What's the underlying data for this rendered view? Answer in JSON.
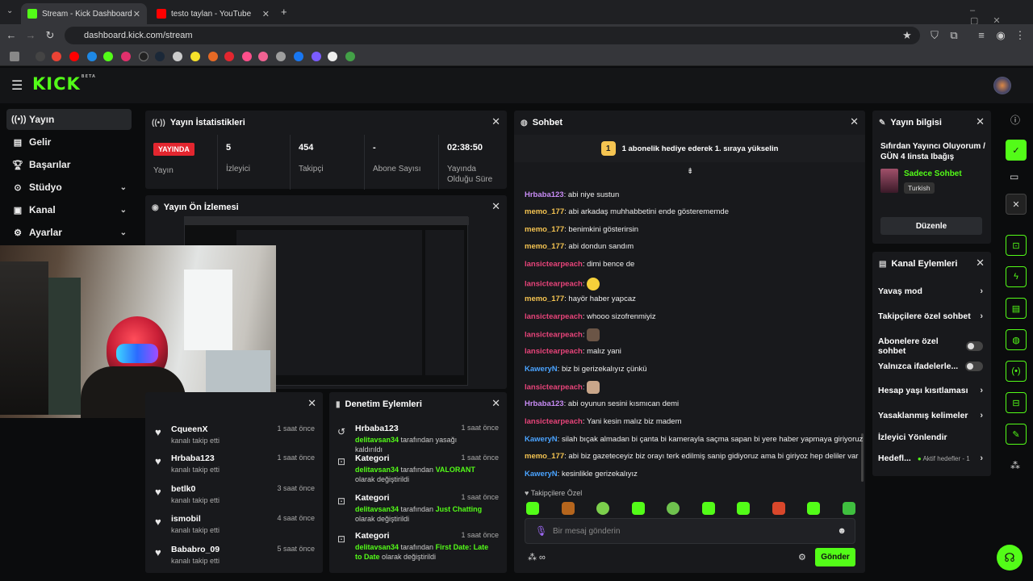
{
  "browser": {
    "tabs": [
      {
        "title": "Stream - Kick Dashboard",
        "active": true
      },
      {
        "title": "testo taylan - YouTube",
        "active": false
      }
    ],
    "url": "dashboard.kick.com/stream"
  },
  "colors": {
    "accent": "#53fc18",
    "live": "#e3262f",
    "panel": "#18191c"
  },
  "kick": {
    "logo": "KICK",
    "logo_tag": "BETA"
  },
  "sidebar": {
    "items": [
      {
        "label": "Yayın",
        "icon": "broadcast-icon"
      },
      {
        "label": "Gelir",
        "icon": "wallet-icon"
      },
      {
        "label": "Başarılar",
        "icon": "trophy-icon"
      },
      {
        "label": "Stüdyo",
        "icon": "studio-icon"
      },
      {
        "label": "Kanal",
        "icon": "channel-icon"
      },
      {
        "label": "Ayarlar",
        "icon": "gear-icon"
      }
    ]
  },
  "stats": {
    "title": "Yayın İstatistikleri",
    "live_badge": "YAYINDA",
    "items": [
      {
        "value": "",
        "label": "Yayın"
      },
      {
        "value": "5",
        "label": "İzleyici"
      },
      {
        "value": "454",
        "label": "Takipçi"
      },
      {
        "value": "-",
        "label": "Abone Sayısı"
      },
      {
        "value": "02:38:50",
        "label": "Yayında Olduğu Süre"
      }
    ]
  },
  "preview": {
    "title": "Yayın Ön İzlemesi"
  },
  "follows": {
    "items": [
      {
        "name": "CqueenX",
        "action": "kanalı takip etti",
        "time": "1 saat önce"
      },
      {
        "name": "Hrbaba123",
        "action": "kanalı takip etti",
        "time": "1 saat önce"
      },
      {
        "name": "betlk0",
        "action": "kanalı takip etti",
        "time": "3 saat önce"
      },
      {
        "name": "ismobil",
        "action": "kanalı takip etti",
        "time": "4 saat önce"
      },
      {
        "name": "Bababro_09",
        "action": "kanalı takip etti",
        "time": "5 saat önce"
      }
    ]
  },
  "moderation": {
    "title": "Denetim Eylemleri",
    "items": [
      {
        "title": "Hrbaba123",
        "actor": "delitavsan34",
        "pre": " tarafından yasağı kaldırıldı",
        "highlight": "",
        "post": "",
        "time": "1 saat önce"
      },
      {
        "title": "Kategori",
        "actor": "delitavsan34",
        "pre": " tarafından ",
        "highlight": "VALORANT",
        "post": " olarak değiştirildi",
        "time": "1 saat önce"
      },
      {
        "title": "Kategori",
        "actor": "delitavsan34",
        "pre": " tarafından ",
        "highlight": "Just Chatting",
        "post": " olarak değiştirildi",
        "time": "1 saat önce"
      },
      {
        "title": "Kategori",
        "actor": "delitavsan34",
        "pre": " tarafından ",
        "highlight": "First Date: Late to Date",
        "post": " olarak değiştirildi",
        "time": "1 saat önce"
      }
    ]
  },
  "chat": {
    "title": "Sohbet",
    "banner": "1 abonelik hediye ederek 1. sıraya yükselin",
    "banner_rank": "1",
    "messages": [
      {
        "user": "Hrbaba123",
        "color": "#c88cf5",
        "text": "abi niye sustun"
      },
      {
        "user": "memo_177",
        "color": "#f5c451",
        "text": "abi arkadaş muhhabbetini ende gösterememde"
      },
      {
        "user": "memo_177",
        "color": "#f5c451",
        "text": "benimkini gösterirsin"
      },
      {
        "user": "memo_177",
        "color": "#f5c451",
        "text": "abi dondun sandım"
      },
      {
        "user": "lansictearpeach",
        "color": "#e8447a",
        "text": "dimi bence de"
      },
      {
        "user": "lansictearpeach",
        "color": "#e8447a",
        "text": ""
      },
      {
        "user": "memo_177",
        "color": "#f5c451",
        "text": "hayör haber yapcaz"
      },
      {
        "user": "lansictearpeach",
        "color": "#e8447a",
        "text": "whooo sizofrenmiyiz"
      },
      {
        "user": "lansictearpeach",
        "color": "#e8447a",
        "text": ""
      },
      {
        "user": "lansictearpeach",
        "color": "#e8447a",
        "text": "malız yani"
      },
      {
        "user": "KaweryN",
        "color": "#4aa3ff",
        "text": "biz bi gerizekalıyız çünkü"
      },
      {
        "user": "lansictearpeach",
        "color": "#e8447a",
        "text": ""
      },
      {
        "user": "Hrbaba123",
        "color": "#c88cf5",
        "text": "abi oyunun sesini kısmıcan demi"
      },
      {
        "user": "lansictearpeach",
        "color": "#e8447a",
        "text": "Yani kesin malız biz madem"
      },
      {
        "user": "KaweryN",
        "color": "#4aa3ff",
        "text": "silah bıçak almadan bi çanta bi kamerayla saçma sapan bi yere haber yapmaya giriyoruz"
      },
      {
        "user": "memo_177",
        "color": "#f5c451",
        "text": "abi biz gazeteceyiz biz orayı terk edilmiş sanip gidiyoruz ama bi giriyoz hep deliler var"
      },
      {
        "user": "KaweryN",
        "color": "#4aa3ff",
        "text": "kesinlikle gerizekalıyız"
      }
    ],
    "followers_only": "Takipçilere Özel",
    "input_placeholder": "Bir mesaj gönderin",
    "send_label": "Gönder"
  },
  "stream_info": {
    "title": "Yayın bilgisi",
    "stream_title": "Sıfırdan Yayıncı Oluyorum / GÜN 4 Iinsta Ibağış",
    "category": "Sadece Sohbet",
    "language": "Turkish",
    "edit_label": "Düzenle"
  },
  "channel_actions": {
    "title": "Kanal Eylemleri",
    "items": [
      {
        "label": "Yavaş mod",
        "control": "chevron"
      },
      {
        "label": "Takipçilere özel sohbet",
        "control": "chevron"
      },
      {
        "label": "Abonelere özel sohbet",
        "control": "toggle"
      },
      {
        "label": "Yalnızca ifadelerle...",
        "control": "toggle"
      },
      {
        "label": "Hesap yaşı kısıtlaması",
        "control": "chevron"
      },
      {
        "label": "Yasaklanmış kelimeler",
        "control": "chevron"
      },
      {
        "label": "İzleyici Yönlendir",
        "control": "none"
      },
      {
        "label": "Hedefl...",
        "control": "chevron"
      }
    ],
    "goals_status": "Aktif hedefler - 1"
  }
}
